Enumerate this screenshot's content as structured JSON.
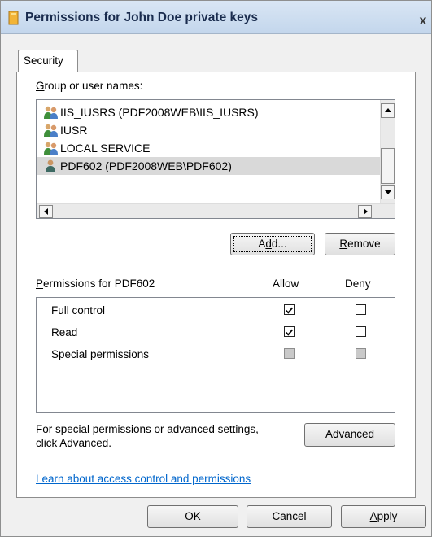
{
  "window": {
    "title": "Permissions for John Doe private keys",
    "close_glyph": "x"
  },
  "tabs": [
    {
      "label": "Security"
    }
  ],
  "users_section": {
    "label_accesskey": "G",
    "label_rest": "roup or user names:",
    "users": [
      {
        "name": "IIS_IUSRS (PDF2008WEB\\IIS_IUSRS)",
        "icon": "user-group-icon"
      },
      {
        "name": "IUSR",
        "icon": "user-group-icon"
      },
      {
        "name": "LOCAL SERVICE",
        "icon": "user-group-icon"
      },
      {
        "name": "PDF602 (PDF2008WEB\\PDF602)",
        "icon": "user-icon",
        "selected": true
      }
    ]
  },
  "buttons": {
    "add": {
      "before": "A",
      "accesskey": "d",
      "after": "d..."
    },
    "remove": {
      "accesskey": "R",
      "after": "emove"
    },
    "advanced": {
      "before": "Ad",
      "accesskey": "v",
      "after": "anced"
    },
    "ok": "OK",
    "cancel": "Cancel",
    "apply": {
      "accesskey": "A",
      "after": "pply"
    }
  },
  "permissions": {
    "label_accesskey": "P",
    "label_rest": "ermissions for PDF602",
    "col_allow": "Allow",
    "col_deny": "Deny",
    "rows": [
      {
        "name": "Full control",
        "allow": true,
        "deny": false,
        "disabled": false
      },
      {
        "name": "Read",
        "allow": true,
        "deny": false,
        "disabled": false
      },
      {
        "name": "Special permissions",
        "allow": false,
        "deny": false,
        "disabled": true
      }
    ]
  },
  "special_note": {
    "line1": "For special permissions or advanced settings,",
    "line2": "click Advanced."
  },
  "learn_link": "Learn about access control and permissions"
}
